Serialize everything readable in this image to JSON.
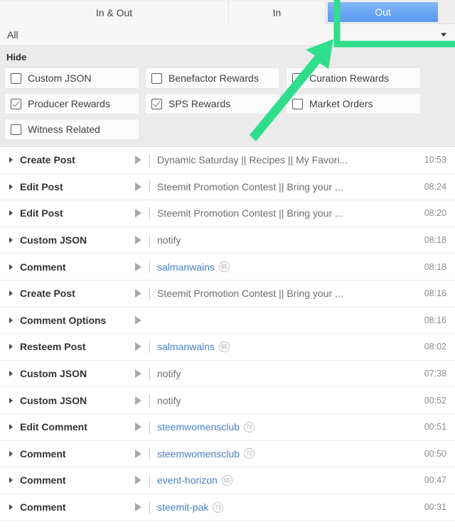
{
  "tabs": [
    {
      "label": "In & Out",
      "active": false
    },
    {
      "label": "In",
      "active": false
    },
    {
      "label": "Out",
      "active": true
    }
  ],
  "account_filter": {
    "value": "All",
    "caret": "chevron-down-icon"
  },
  "hide_panel": {
    "title": "Hide",
    "options": [
      {
        "label": "Custom JSON",
        "checked": false
      },
      {
        "label": "Benefactor Rewards",
        "checked": false
      },
      {
        "label": "Curation Rewards",
        "checked": false
      },
      {
        "label": "Producer Rewards",
        "checked": true
      },
      {
        "label": "SPS Rewards",
        "checked": true
      },
      {
        "label": "Market Orders",
        "checked": false
      },
      {
        "label": "Witness Related",
        "checked": false
      }
    ]
  },
  "history": {
    "rows": [
      {
        "op": "Create Post",
        "detail": "Dynamic Saturday || Recipes || My Favori...",
        "is_link": false,
        "rep": "",
        "time": "10:53"
      },
      {
        "op": "Edit Post",
        "detail": "Steemit Promotion Contest || Bring your ...",
        "is_link": false,
        "rep": "",
        "time": "08:24"
      },
      {
        "op": "Edit Post",
        "detail": "Steemit Promotion Contest || Bring your ...",
        "is_link": false,
        "rep": "",
        "time": "08:20"
      },
      {
        "op": "Custom JSON",
        "detail": "notify",
        "is_link": false,
        "rep": "",
        "time": "08:18"
      },
      {
        "op": "Comment",
        "detail": "salmanwains",
        "is_link": true,
        "rep": "65",
        "time": "08:18"
      },
      {
        "op": "Create Post",
        "detail": "Steemit Promotion Contest || Bring your ...",
        "is_link": false,
        "rep": "",
        "time": "08:16"
      },
      {
        "op": "Comment Options",
        "detail": "",
        "is_link": false,
        "rep": "",
        "time": "08:16"
      },
      {
        "op": "Resteem Post",
        "detail": "salmanwains",
        "is_link": true,
        "rep": "65",
        "time": "08:02"
      },
      {
        "op": "Custom JSON",
        "detail": "notify",
        "is_link": false,
        "rep": "",
        "time": "07:38"
      },
      {
        "op": "Custom JSON",
        "detail": "notify",
        "is_link": false,
        "rep": "",
        "time": "00:52"
      },
      {
        "op": "Edit Comment",
        "detail": "steemwomensclub",
        "is_link": true,
        "rep": "72",
        "time": "00:51"
      },
      {
        "op": "Comment",
        "detail": "steemwomensclub",
        "is_link": true,
        "rep": "72",
        "time": "00:50"
      },
      {
        "op": "Comment",
        "detail": "event-horizon",
        "is_link": true,
        "rep": "65",
        "time": "00:47"
      },
      {
        "op": "Comment",
        "detail": "steemit-pak",
        "is_link": true,
        "rep": "71",
        "time": "00:31"
      }
    ]
  },
  "annotation": {
    "color": "#2EDE8C",
    "shapes": [
      "highlight-box-around-out-tab",
      "arrow-pointing-to-out-tab"
    ]
  }
}
